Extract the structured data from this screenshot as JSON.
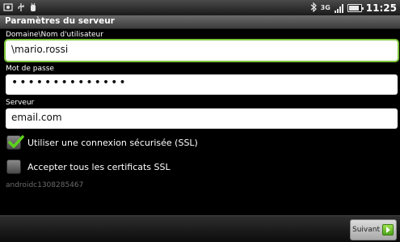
{
  "status_bar": {
    "left_icons": [
      "photo-notification-icon",
      "usb-icon",
      "debug-icon"
    ],
    "right_icons": [
      "bluetooth-icon",
      "3g-icon",
      "signal-icon",
      "battery-icon"
    ],
    "network_type": "3G",
    "time": "11:25"
  },
  "title": "Paramètres du serveur",
  "fields": {
    "username": {
      "label": "Domaine\\Nom d'utilisateur",
      "value": "\\mario.rossi"
    },
    "password": {
      "label": "Mot de passe",
      "value": "••••••••••••••"
    },
    "server": {
      "label": "Serveur",
      "value": "email.com"
    }
  },
  "checkboxes": {
    "ssl": {
      "label": "Utiliser une connexion sécurisée (SSL)",
      "checked": true
    },
    "accept_certs": {
      "label": "Accepter tous les certificats SSL",
      "checked": false
    }
  },
  "account_id": "androidc1308285467",
  "footer": {
    "next_label": "Suivant"
  },
  "colors": {
    "accent_green": "#7cc43a",
    "background": "#000000"
  }
}
